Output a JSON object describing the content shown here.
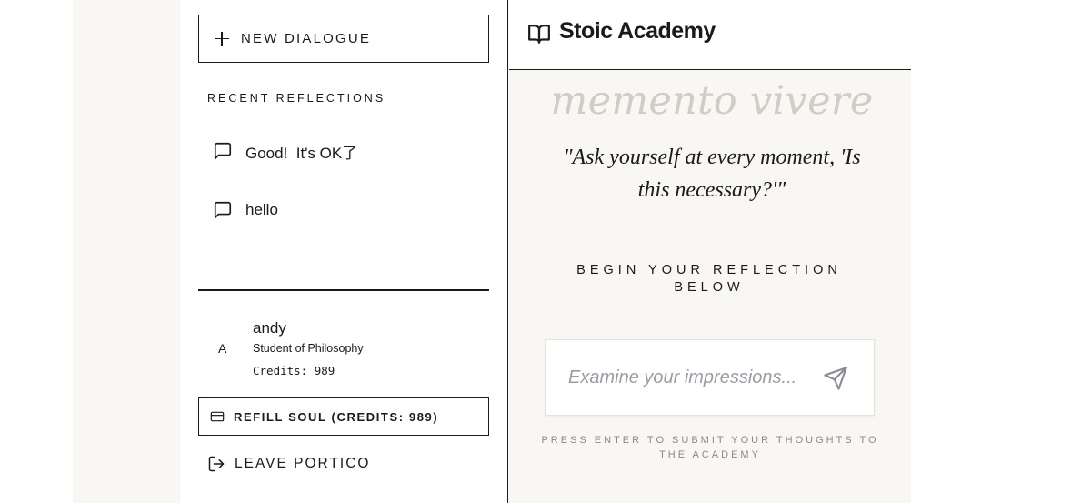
{
  "sidebar": {
    "new_dialogue_label": "NEW DIALOGUE",
    "recent_heading": "RECENT REFLECTIONS",
    "conversations": [
      {
        "title": "Good!  It's OK了"
      },
      {
        "title": "hello"
      }
    ],
    "user": {
      "avatar_initial": "A",
      "name": "andy",
      "role": "Student of Philosophy",
      "credits": "Credits: 989"
    },
    "refill_label": "REFILL SOUL (CREDITS: 989)",
    "leave_label": "LEAVE PORTICO"
  },
  "header": {
    "title": "Stoic Academy"
  },
  "main": {
    "motto": "memento vivere",
    "quote": "\"Ask yourself at every moment, 'Is this necessary?'\"",
    "begin_prompt": "BEGIN YOUR REFLECTION BELOW",
    "input_placeholder": "Examine your impressions...",
    "hint": "PRESS ENTER TO SUBMIT YOUR THOUGHTS TO THE ACADEMY"
  },
  "colors": {
    "background": "#f8f7f3",
    "ink": "#1a1a1a",
    "motto": "#cfcdc6",
    "placeholder": "#9c9aa6",
    "hint": "#8b8980"
  },
  "icons": [
    "plus-icon",
    "message-square-icon",
    "credit-card-icon",
    "log-out-icon",
    "book-open-icon",
    "send-icon"
  ]
}
